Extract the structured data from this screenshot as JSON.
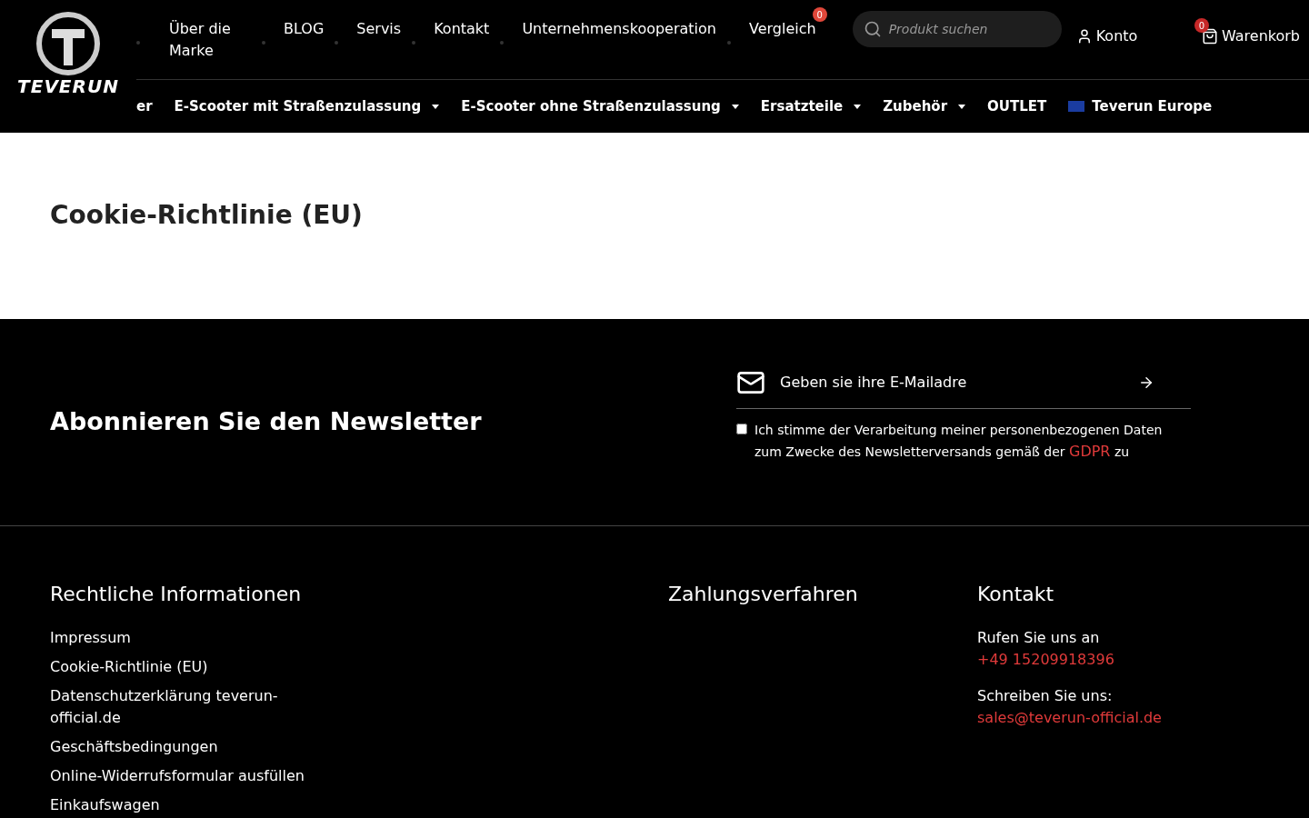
{
  "header": {
    "logo_text": "TEVERUN",
    "top_nav": [
      {
        "label": "Über die Marke"
      },
      {
        "label": "BLOG"
      },
      {
        "label": "Servis"
      },
      {
        "label": "Kontakt"
      },
      {
        "label": "Unternehmenskooperation"
      },
      {
        "label": "Vergleich",
        "badge": "0"
      }
    ],
    "search": {
      "placeholder": "Produkt suchen"
    },
    "account": {
      "label": "Konto"
    },
    "cart": {
      "label": "Warenkorb",
      "badge": "0"
    },
    "main_nav": [
      {
        "label": "er",
        "dropdown": false,
        "kind": "text"
      },
      {
        "label": "E-Scooter mit Straßenzulassung",
        "dropdown": true,
        "kind": "text"
      },
      {
        "label": "E-Scooter ohne Straßenzulassung",
        "dropdown": true,
        "kind": "text"
      },
      {
        "label": "Ersatzteile",
        "dropdown": true,
        "kind": "text"
      },
      {
        "label": "Zubehör",
        "dropdown": true,
        "kind": "text"
      },
      {
        "label": "OUTLET",
        "dropdown": false,
        "kind": "text"
      },
      {
        "label": "Teverun Europe",
        "dropdown": false,
        "kind": "flag"
      }
    ]
  },
  "page": {
    "title": "Cookie-Richtlinie (EU)"
  },
  "newsletter": {
    "title": "Abonnieren Sie den Newsletter",
    "email_value": "Geben sie ihre E-Mailadre",
    "consent": {
      "checked": false,
      "text_before": "Ich stimme der Verarbeitung meiner personenbezogenen Daten zum Zwecke des Newsletterversands gemäß der",
      "link": "GDPR",
      "text_after": "zu"
    }
  },
  "footer": {
    "legal": {
      "title": "Rechtliche Informationen",
      "links": [
        "Impressum",
        "Cookie-Richtlinie (EU)",
        "Datenschutzerklärung teverun-official.de",
        "Geschäftsbedingungen",
        "Online-Widerrufsformular ausfüllen",
        "Einkaufswagen"
      ]
    },
    "payment": {
      "title": "Zahlungsverfahren"
    },
    "contact": {
      "title": "Kontakt",
      "items": [
        {
          "label": "Rufen Sie uns an",
          "value": "+49 15209918396"
        },
        {
          "label": "Schreiben Sie uns:",
          "value": "sales@teverun-official.de"
        }
      ]
    }
  }
}
